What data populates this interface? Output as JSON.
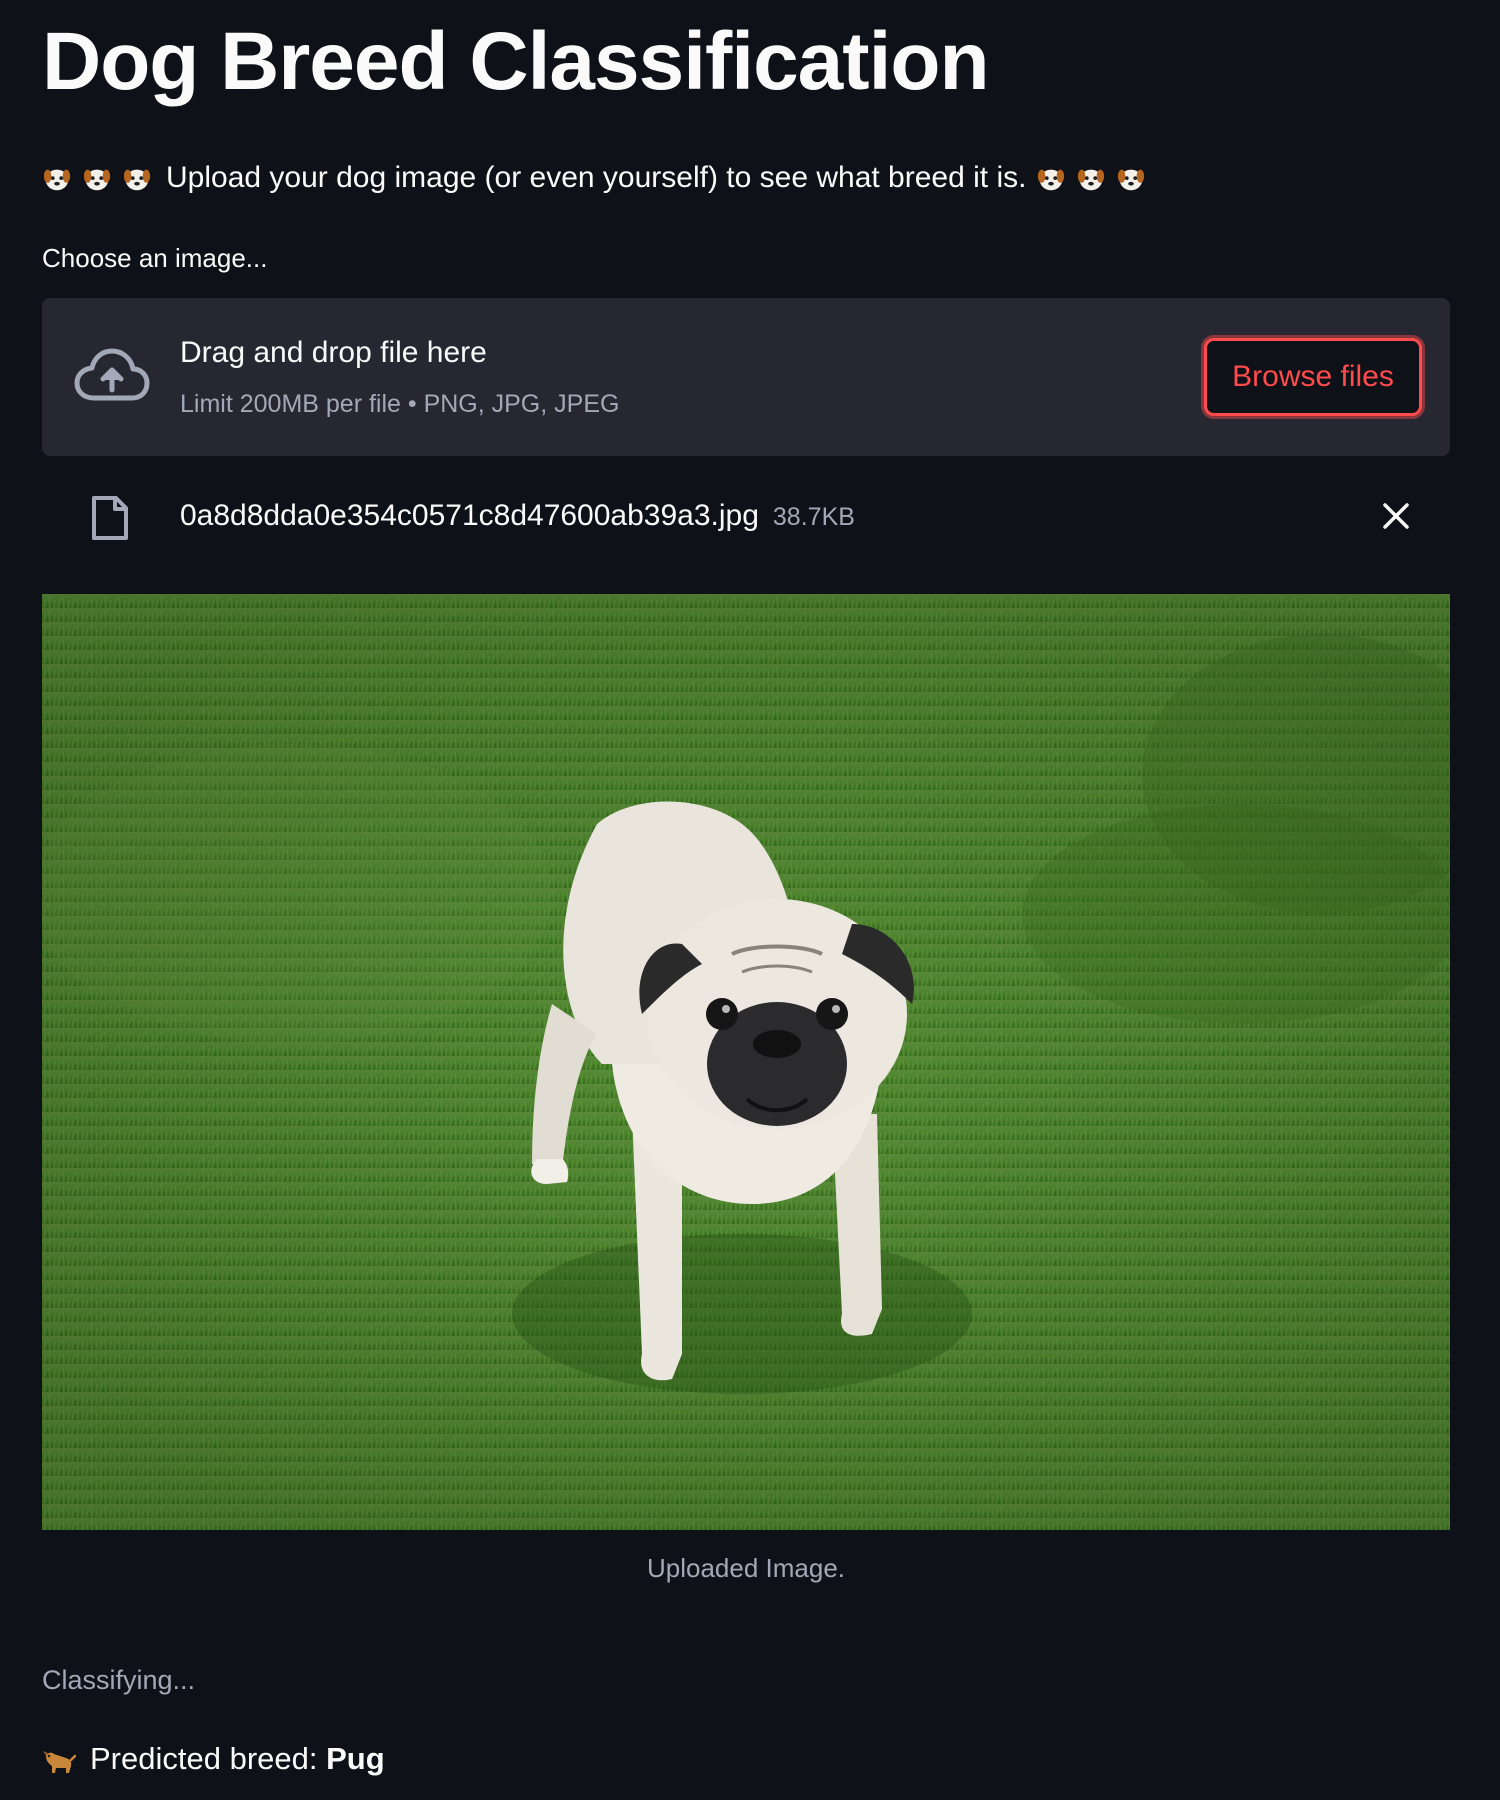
{
  "page": {
    "title": "Dog Breed Classification",
    "subtitle": "Upload your dog image (or even yourself) to see what breed it is.",
    "subtitle_emoji": "dog-face-emoji"
  },
  "uploader": {
    "label": "Choose an image...",
    "drop_text": "Drag and drop file here",
    "limit_text": "Limit 200MB per file • PNG, JPG, JPEG",
    "browse_label": "Browse files",
    "accent_color": "#ff4b4b"
  },
  "file": {
    "name": "0a8d8dda0e354c0571c8d47600ab39a3.jpg",
    "size": "38.7KB"
  },
  "image": {
    "caption": "Uploaded Image.",
    "subject": "pug-on-grass-photo"
  },
  "result": {
    "status": "Classifying...",
    "prefix": "Predicted breed: ",
    "breed": "Pug",
    "icon": "dog-emoji"
  },
  "theme": {
    "background": "#0e1117",
    "panel": "#262730",
    "text": "#fafafa",
    "muted": "#a3a8b8"
  }
}
